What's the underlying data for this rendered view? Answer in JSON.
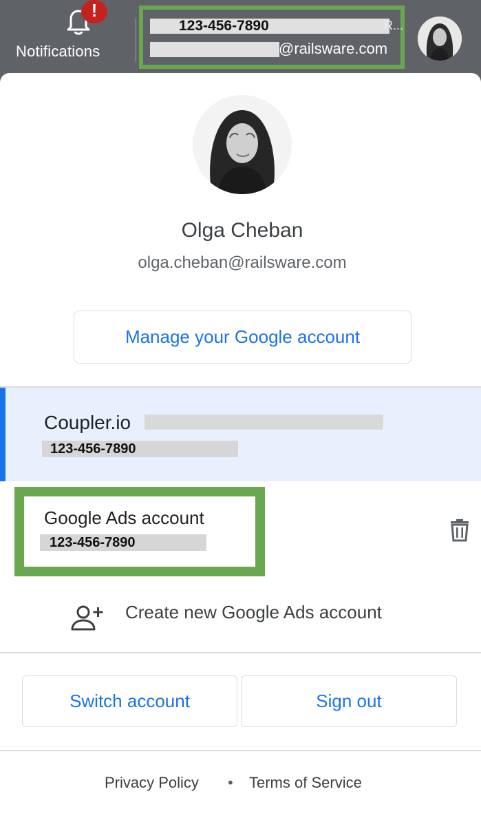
{
  "topbar": {
    "notifications_label": "Notifications",
    "notifications_badge": "!",
    "account_id": "123-456-7890",
    "account_name_tail": "R...",
    "account_email_domain": "@railsware.com"
  },
  "profile": {
    "name": "Olga Cheban",
    "email": "olga.cheban@railsware.com",
    "manage_label": "Manage your Google account"
  },
  "accounts": [
    {
      "name": "Coupler.io",
      "id": "123-456-7890",
      "selected": true
    },
    {
      "name": "Google Ads account",
      "id": "123-456-7890",
      "selected": false
    }
  ],
  "create_account_label": "Create new Google Ads account",
  "actions": {
    "switch_label": "Switch account",
    "signout_label": "Sign out"
  },
  "footer": {
    "privacy": "Privacy Policy",
    "separator": "•",
    "terms": "Terms of Service"
  },
  "colors": {
    "accent": "#1a73e8",
    "highlight_border": "#6aa84f",
    "topbar_bg": "#5f6368",
    "selected_row_bg": "#e8f0fe",
    "badge": "#c5221f"
  },
  "icons": {
    "notifications": "bell-icon",
    "delete": "trash-icon",
    "create": "person-add-icon"
  }
}
